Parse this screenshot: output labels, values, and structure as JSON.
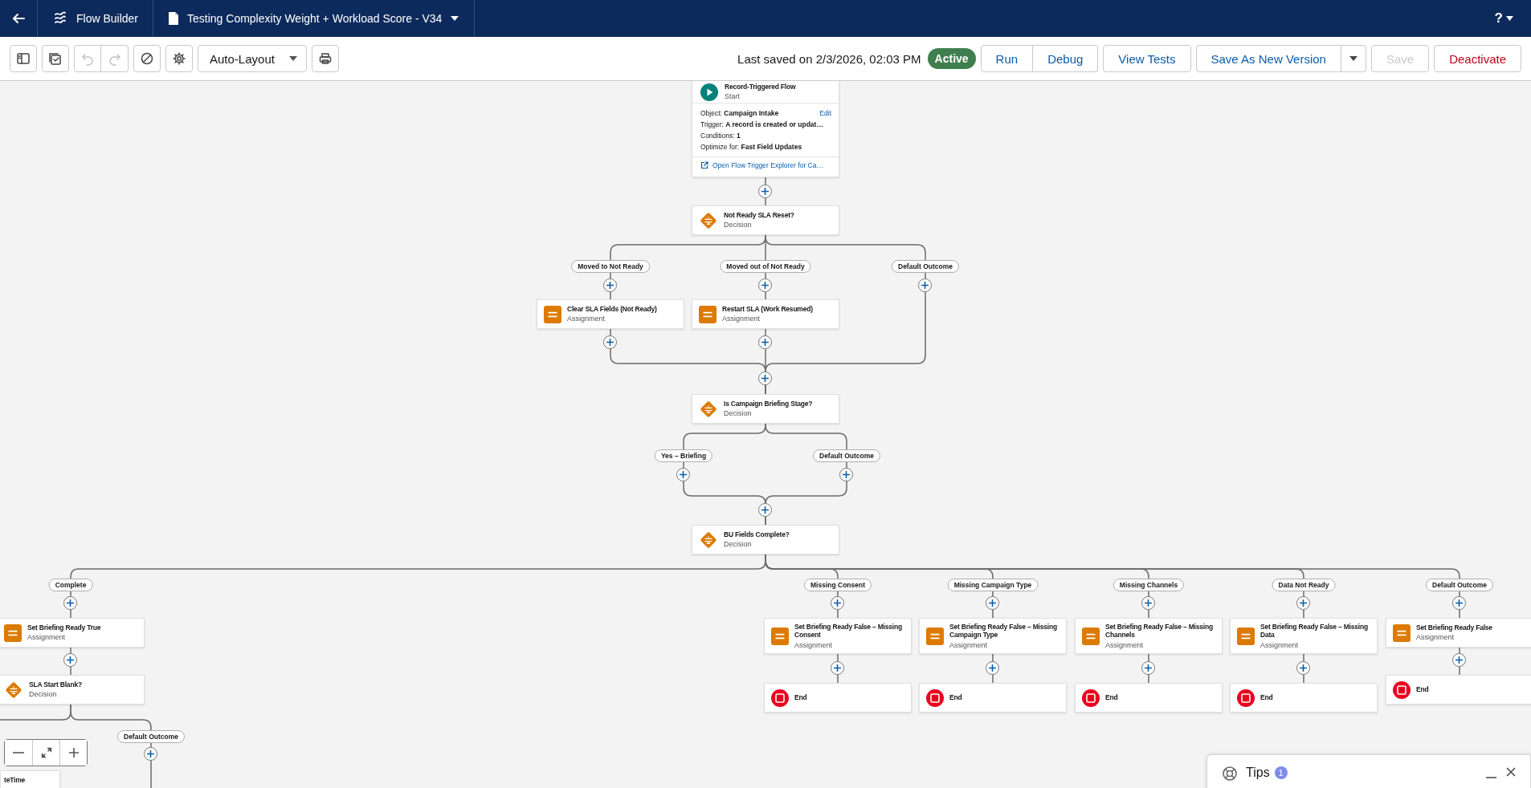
{
  "header": {
    "app_title": "Flow Builder",
    "flow_title": "Testing Complexity Weight + Workload Score - V34",
    "help": "?"
  },
  "toolbar": {
    "controls": [
      {
        "kind": "sidebar",
        "disabled": false
      },
      {
        "kind": "checklist",
        "disabled": false
      },
      {
        "kind": "undo",
        "disabled": true
      },
      {
        "kind": "redo",
        "disabled": true
      },
      {
        "kind": "block",
        "disabled": false
      },
      {
        "kind": "gear",
        "disabled": false
      },
      {
        "kind": "select",
        "label": "Auto-Layout"
      },
      {
        "kind": "print",
        "disabled": false
      }
    ],
    "last_saved": "Last saved on 2/3/2026, 02:03 PM",
    "status": "Active",
    "button_groups": [
      [
        {
          "kind": "text",
          "label": "Run",
          "disabled": false
        },
        {
          "kind": "text",
          "label": "Debug",
          "disabled": false
        }
      ],
      [
        {
          "kind": "text",
          "label": "View Tests",
          "disabled": false
        }
      ],
      [
        {
          "kind": "text",
          "label": "Save As New Version",
          "disabled": false
        },
        {
          "kind": "menu",
          "disabled": false
        }
      ],
      [
        {
          "kind": "text",
          "label": "Save",
          "disabled": true
        }
      ],
      [
        {
          "kind": "destructive",
          "label": "Deactivate",
          "disabled": false
        }
      ]
    ]
  },
  "canvas": {
    "nodes": [
      {
        "kind": "start",
        "title": "Record-Triggered Flow",
        "subtitle": "Start",
        "details": [
          "Object: **Campaign Intake**",
          "Trigger:  **A record is created or updat…**",
          "Conditions: **1**",
          "Optimize for: **Fast Field Updates**"
        ],
        "edit_link": "Edit",
        "explorer_link": "Open Flow Trigger Explorer for Ca…"
      },
      {
        "kind": "decision",
        "title": "Not Ready SLA Reset?",
        "subtitle": "Decision"
      },
      {
        "kind": "assignment",
        "title": "Clear SLA Fields (Not Ready)",
        "subtitle": "Assignment"
      },
      {
        "kind": "assignment",
        "title": "Restart SLA (Work Resumed)",
        "subtitle": "Assignment"
      },
      {
        "kind": "decision",
        "title": "Is Campaign Briefing Stage?",
        "subtitle": "Decision"
      },
      {
        "kind": "decision",
        "title": "BU Fields Complete?",
        "subtitle": "Decision"
      },
      {
        "kind": "assignment",
        "title": "Set Briefing Ready True",
        "subtitle": "Assignment"
      },
      {
        "kind": "decision",
        "title": "SLA Start Blank?",
        "subtitle": "Decision"
      },
      {
        "kind": "assignment",
        "title": "Set Briefing Ready False – Missing Consent",
        "subtitle": "Assignment"
      },
      {
        "kind": "assignment",
        "title": "Set Briefing Ready False – Missing Campaign Type",
        "subtitle": "Assignment"
      },
      {
        "kind": "assignment",
        "title": "Set Briefing Ready False – Missing Channels",
        "subtitle": "Assignment"
      },
      {
        "kind": "assignment",
        "title": "Set Briefing Ready False – Missing Data",
        "subtitle": "Assignment"
      },
      {
        "kind": "assignment",
        "title": "Set Briefing Ready False",
        "subtitle": "Assignment"
      },
      {
        "kind": "end",
        "title": "End"
      },
      {
        "kind": "end",
        "title": "End"
      },
      {
        "kind": "end",
        "title": "End"
      },
      {
        "kind": "end",
        "title": "End"
      },
      {
        "kind": "end",
        "title": "End"
      },
      {
        "kind": "clipped",
        "title": "teTime"
      }
    ],
    "branch_labels": [
      "Moved to Not Ready",
      "Moved out of Not Ready",
      "Default Outcome",
      "Yes – Briefing",
      "Default Outcome",
      "Complete",
      "Missing Consent",
      "Missing Campaign Type",
      "Missing Channels",
      "Data Not Ready",
      "Default Outcome",
      "Default Outcome"
    ]
  },
  "tips": {
    "title": "Tips",
    "count": "1"
  }
}
